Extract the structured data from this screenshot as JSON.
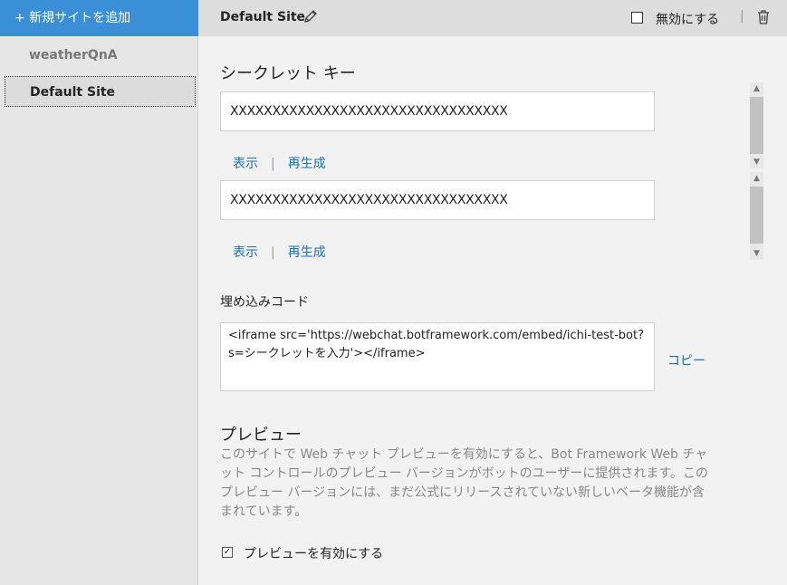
{
  "sidebar": {
    "add_site": "+ 新規サイトを追加",
    "sites": [
      {
        "label": "weatherQnA"
      },
      {
        "label": "Default Site"
      }
    ]
  },
  "header": {
    "title": "Default Site",
    "disable_label": "無効にする",
    "separator": "|"
  },
  "secret": {
    "heading": "シークレット キー",
    "key1": "XXXXXXXXXXXXXXXXXXXXXXXXXXXXXXXXX",
    "key2": "XXXXXXXXXXXXXXXXXXXXXXXXXXXXXXXXX",
    "show_label": "表示",
    "regen_label": "再生成",
    "separator": "|"
  },
  "embed": {
    "heading": "埋め込みコード",
    "code": "<iframe src='https://webchat.botframework.com/embed/ichi-test-bot?s=シークレットを入力'></iframe>",
    "copy_label": "コピー"
  },
  "preview": {
    "heading": "プレビュー",
    "description": "このサイトで Web チャット プレビューを有効にすると、Bot Framework Web チャット コントロールのプレビュー バージョンがボットのユーザーに提供されます。このプレビュー バージョンには、まだ公式にリリースされていない新しいベータ機能が含まれています。",
    "enable_label": "プレビューを有効にする",
    "enabled": true
  },
  "colors": {
    "accent": "#3a8fd6",
    "link": "#1a6fb8"
  }
}
